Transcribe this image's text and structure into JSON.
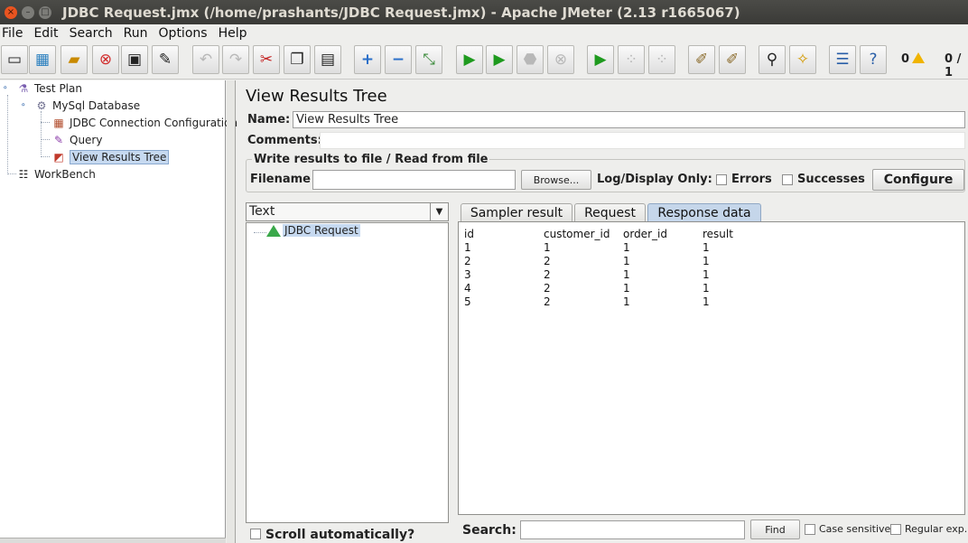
{
  "window": {
    "title": "JDBC Request.jmx (/home/prashants/JDBC Request.jmx) - Apache JMeter (2.13 r1665067)",
    "close_glyph": "×",
    "minimize_glyph": "–",
    "maximize_glyph": "□"
  },
  "menu": [
    "File",
    "Edit",
    "Search",
    "Run",
    "Options",
    "Help"
  ],
  "toolbar": {
    "error_count": "0",
    "threads": "0 / 1",
    "icons": [
      "new-icon",
      "templates-icon",
      "open-icon",
      "close-icon",
      "save-icon",
      "save-as-icon",
      "undo-icon",
      "redo-icon",
      "cut-icon",
      "copy-icon",
      "paste-icon",
      "expand-icon",
      "collapse-icon",
      "toggle-icon",
      "start-icon",
      "start-no-pause-icon",
      "stop-icon",
      "shutdown-icon",
      "remote-start-icon",
      "remote-stop-icon",
      "remote-shutdown-icon",
      "clear-icon",
      "clear-all-icon",
      "search-icon",
      "reset-search-icon",
      "function-helper-icon",
      "help-icon"
    ]
  },
  "tree": {
    "items": [
      {
        "label": "Test Plan",
        "icon": "test-plan-icon"
      },
      {
        "label": "MySql Database",
        "icon": "thread-group-icon"
      },
      {
        "label": "JDBC Connection Configuration",
        "icon": "config-element-icon"
      },
      {
        "label": "Query",
        "icon": "sampler-icon"
      },
      {
        "label": "View Results Tree",
        "icon": "listener-icon"
      },
      {
        "label": "WorkBench",
        "icon": "workbench-icon"
      }
    ]
  },
  "panel": {
    "heading": "View Results Tree",
    "name_label": "Name:",
    "name_value": "View Results Tree",
    "comments_label": "Comments:",
    "file_group_title": "Write results to file / Read from file",
    "filename_label": "Filename",
    "filename_value": "",
    "browse_label": "Browse...",
    "log_display_label": "Log/Display Only:",
    "errors_label": "Errors",
    "successes_label": "Successes",
    "configure_label": "Configure"
  },
  "results": {
    "renderer": "Text",
    "sample_label": "JDBC Request",
    "scroll_label": "Scroll automatically?",
    "tabs": [
      "Sampler result",
      "Request",
      "Response data"
    ],
    "active_tab": "Response data",
    "response_columns": [
      "id",
      "customer_id",
      "order_id",
      "result"
    ],
    "response_rows": [
      [
        "1",
        "1",
        "1",
        "1"
      ],
      [
        "2",
        "2",
        "1",
        "1"
      ],
      [
        "3",
        "2",
        "1",
        "1"
      ],
      [
        "4",
        "2",
        "1",
        "1"
      ],
      [
        "5",
        "2",
        "1",
        "1"
      ]
    ],
    "search_label": "Search:",
    "search_value": "",
    "find_label": "Find",
    "case_sensitive_label": "Case sensitive",
    "regular_exp_label": "Regular exp."
  }
}
